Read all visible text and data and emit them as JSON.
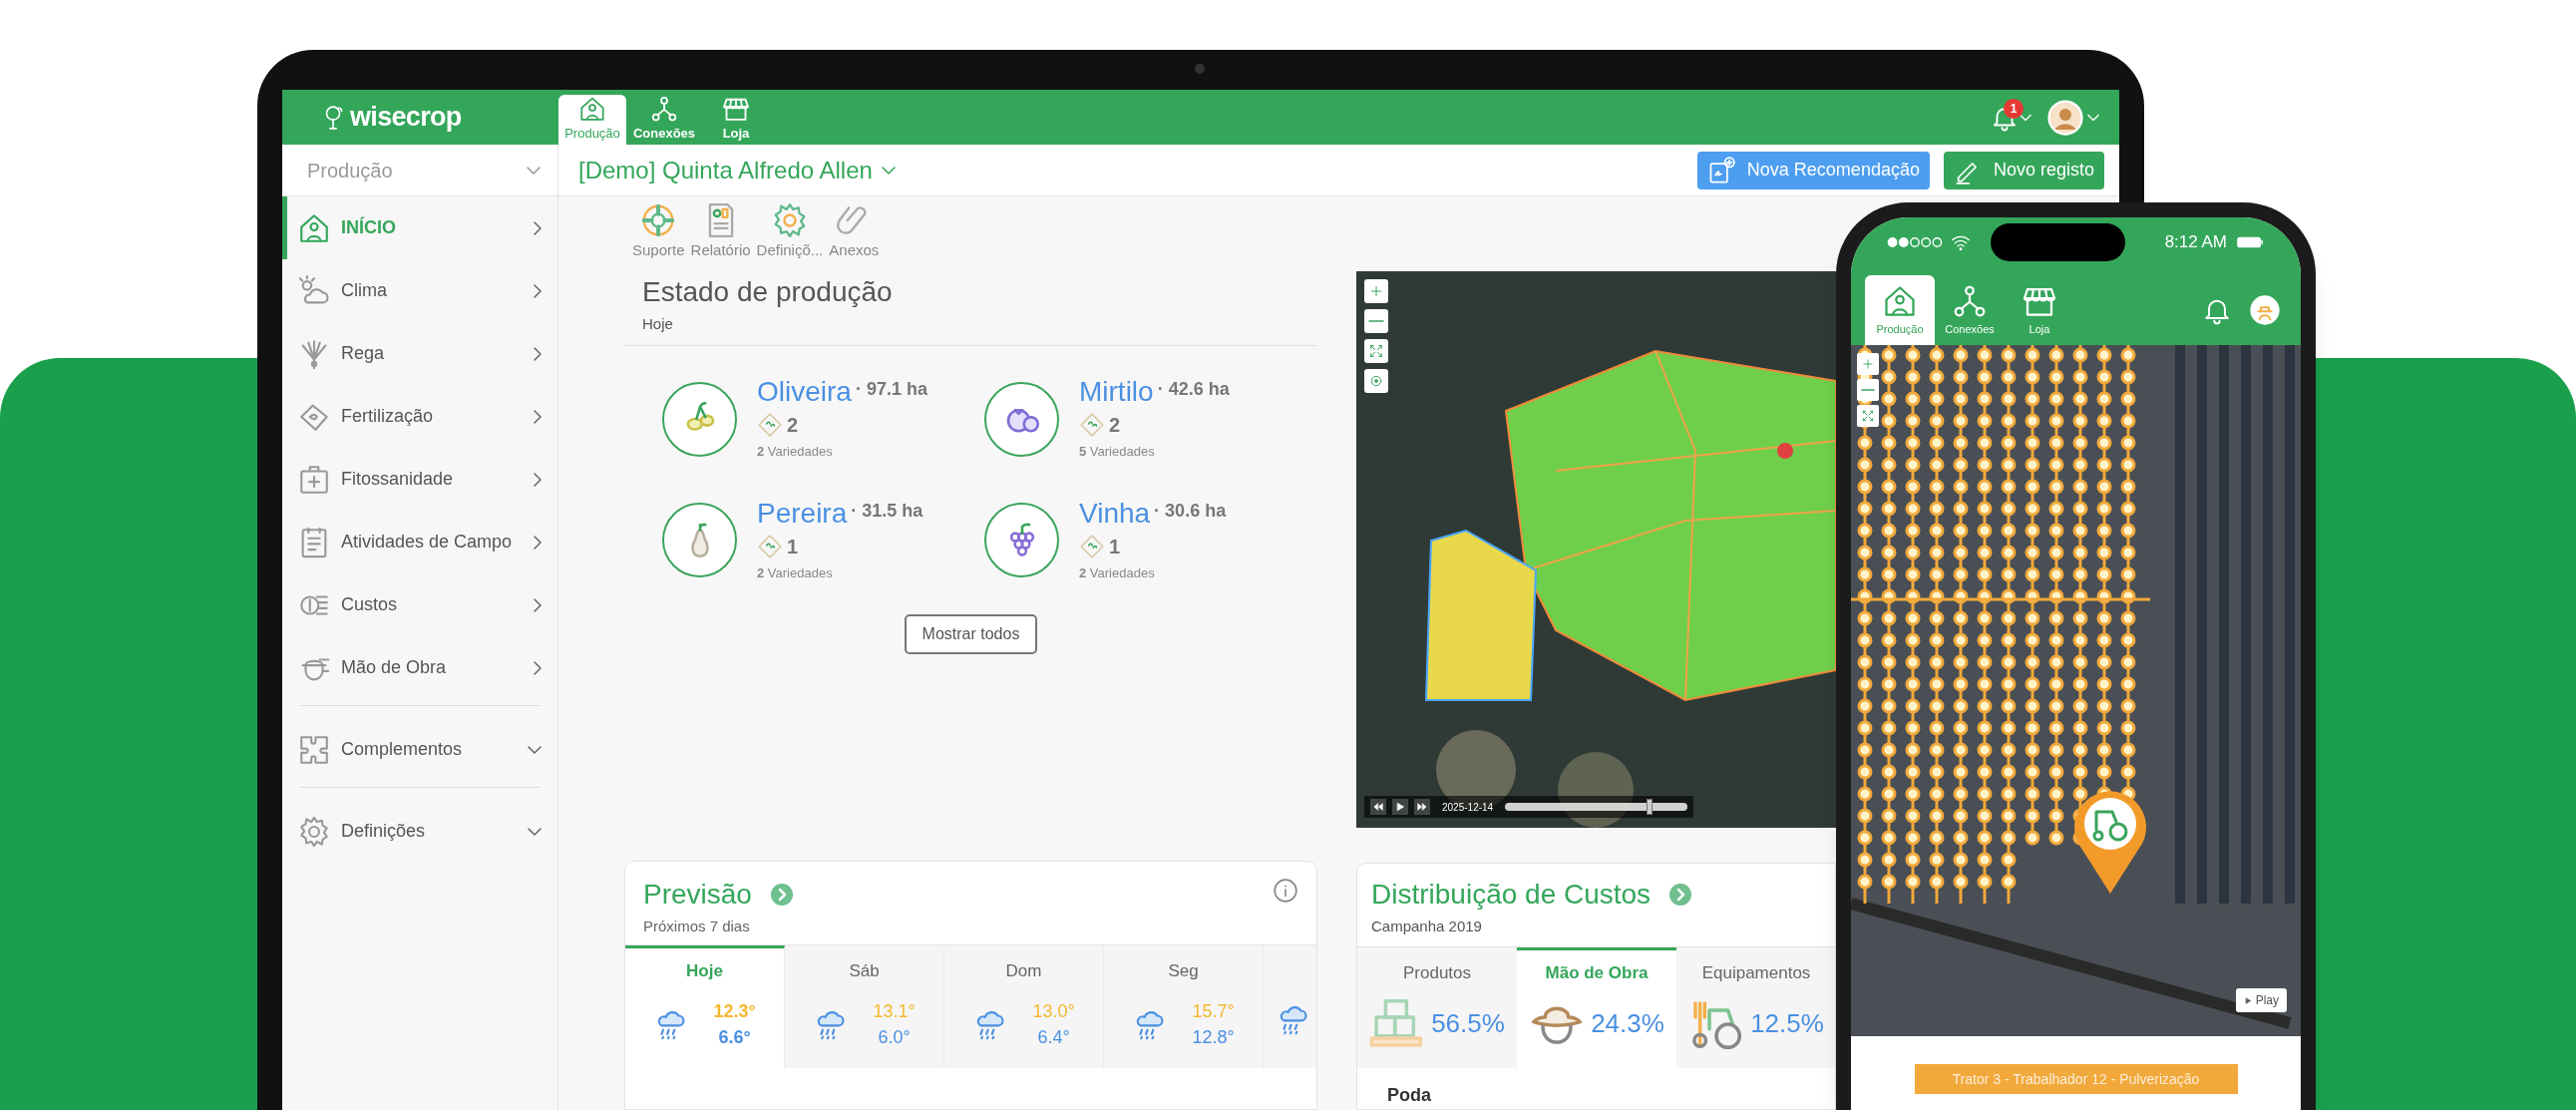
{
  "laptop": {
    "app_bar": {
      "logo": "wisecrop",
      "tabs": [
        {
          "label": "Produção",
          "selected": true
        },
        {
          "label": "Conexões",
          "selected": false
        },
        {
          "label": "Loja",
          "selected": false
        }
      ],
      "notification_badge": "1"
    },
    "header": {
      "module_select": "Produção",
      "farm_select": "[Demo] Quinta Alfredo Allen",
      "buttons": [
        {
          "label": "Nova Recomendação",
          "kind": "recommendation"
        },
        {
          "label": "Novo registo",
          "kind": "record"
        }
      ]
    },
    "sidebar": {
      "items": [
        {
          "label": "INÍCIO",
          "kind": "link",
          "selected": true
        },
        {
          "label": "Clima",
          "kind": "link",
          "selected": false
        },
        {
          "label": "Rega",
          "kind": "link",
          "selected": false
        },
        {
          "label": "Fertilização",
          "kind": "link",
          "selected": false
        },
        {
          "label": "Fitossanidade",
          "kind": "link",
          "selected": false
        },
        {
          "label": "Atividades de Campo",
          "kind": "link",
          "selected": false
        },
        {
          "label": "Custos",
          "kind": "link",
          "selected": false
        },
        {
          "label": "Mão de Obra",
          "kind": "link",
          "selected": false
        },
        {
          "label": "Complementos",
          "kind": "group",
          "selected": false
        },
        {
          "label": "Definições",
          "kind": "group",
          "selected": false
        }
      ]
    },
    "toolbar": [
      "Suporte",
      "Relatório",
      "Definiçõ...",
      "Anexos"
    ],
    "production_status": {
      "title": "Estado de produção",
      "subtitle": "Hoje",
      "crops": [
        {
          "name": "Oliveira",
          "area": "· 97.1 ha",
          "count": "2",
          "varieties": "**2** Variedades"
        },
        {
          "name": "Mirtilo",
          "area": "· 42.6 ha",
          "count": "2",
          "varieties": "**5** Variedades"
        },
        {
          "name": "Pereira",
          "area": "· 31.5 ha",
          "count": "1",
          "varieties": "**2** Variedades"
        },
        {
          "name": "Vinha",
          "area": "· 30.6 ha",
          "count": "1",
          "varieties": "**2** Variedades"
        }
      ],
      "show_all_button": "Mostrar todos"
    },
    "map": {
      "date": "2025-12-14",
      "timeline": {
        "level": 0.79
      }
    },
    "forecast": {
      "title": "Previsão",
      "subtitle": "Próximos 7 dias",
      "days": [
        {
          "label": "Hoje",
          "selected": true,
          "high": "12.3°",
          "low": "6.6°"
        },
        {
          "label": "Sáb",
          "selected": false,
          "high": "13.1°",
          "low": "6.0°"
        },
        {
          "label": "Dom",
          "selected": false,
          "high": "13.0°",
          "low": "6.4°"
        },
        {
          "label": "Seg",
          "selected": false,
          "high": "15.7°",
          "low": "12.8°"
        }
      ]
    },
    "costs": {
      "title": "Distribuição de Custos",
      "subtitle": "Campanha 2019",
      "tabs": [
        {
          "label": "Produtos",
          "selected": false,
          "share": "56.5%"
        },
        {
          "label": "Mão de Obra",
          "selected": true,
          "share": "24.3%"
        },
        {
          "label": "Equipamentos",
          "selected": false,
          "share": "12.5%"
        }
      ],
      "first_item": "Poda"
    }
  },
  "phone": {
    "status_bar": {
      "time": "8:12 AM"
    },
    "tabs": [
      {
        "label": "Produção",
        "selected": true
      },
      {
        "label": "Conexões",
        "selected": false
      },
      {
        "label": "Loja",
        "selected": false
      }
    ],
    "map": {
      "play_button": "Play"
    },
    "activity_banner": "Trator 3 - Trabalhador 12 - Pulverização"
  }
}
